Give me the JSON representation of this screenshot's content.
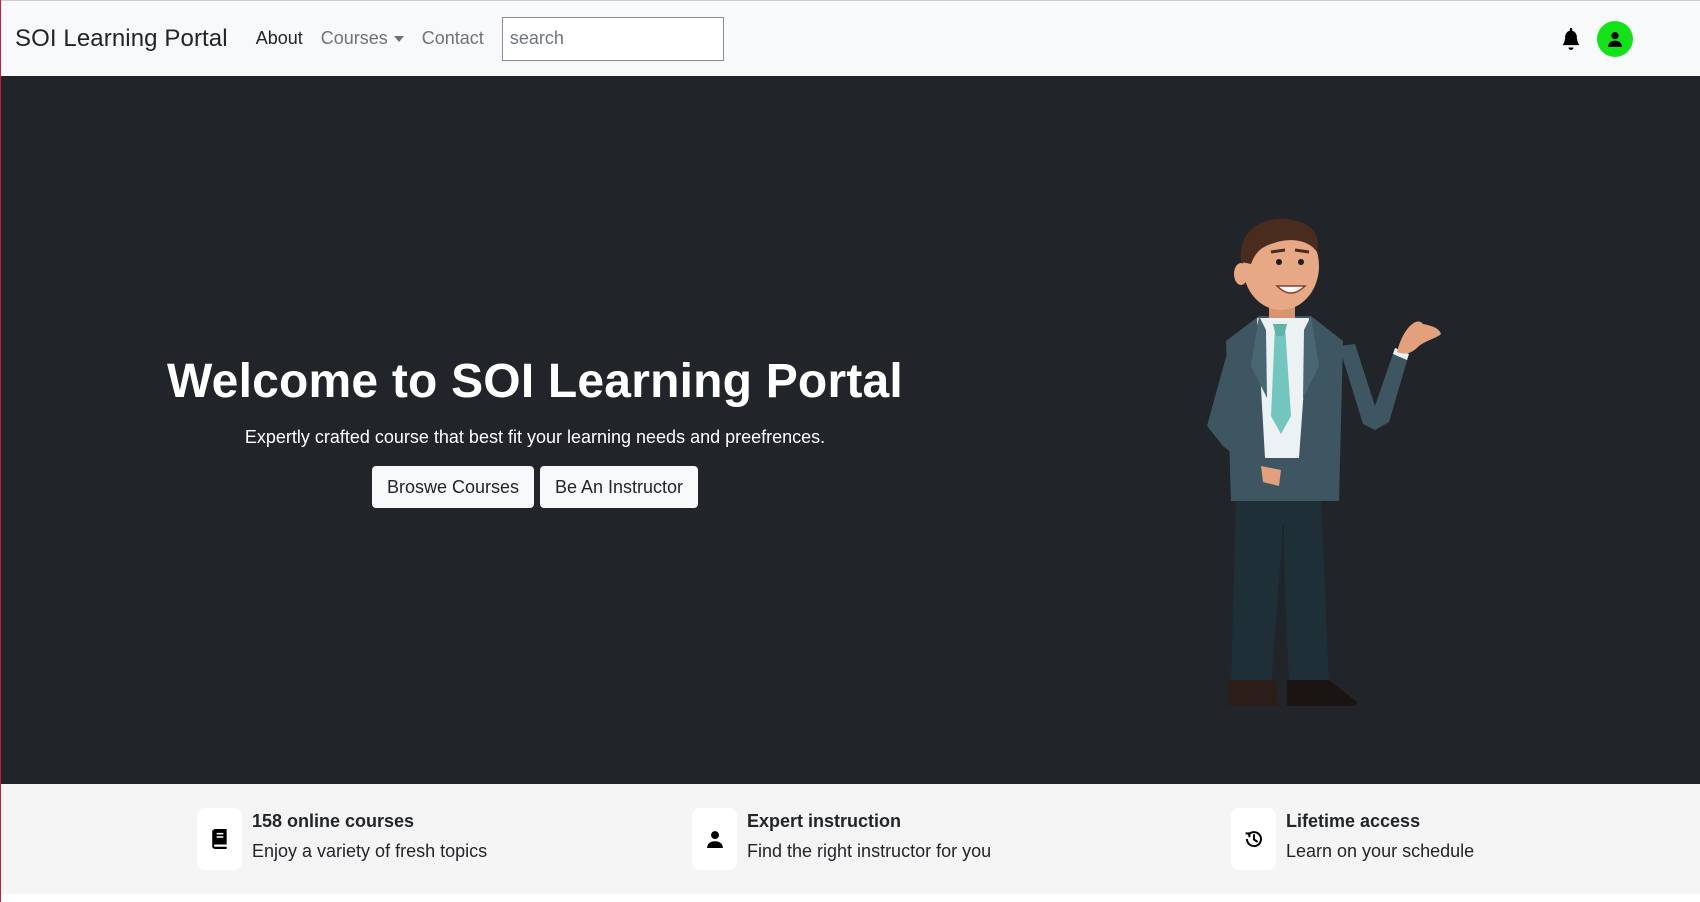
{
  "nav": {
    "brand": "SOI Learning Portal",
    "links": [
      {
        "label": "About"
      },
      {
        "label": "Courses"
      },
      {
        "label": "Contact"
      }
    ],
    "search_placeholder": "search",
    "avatar_color": "#14e11a"
  },
  "hero": {
    "title": "Welcome to SOI Learning Portal",
    "subtitle": "Expertly crafted course that best fit your learning needs and preefrences.",
    "buttons": [
      {
        "label": "Broswe Courses"
      },
      {
        "label": "Be An Instructor"
      }
    ],
    "background": "#212529"
  },
  "features": [
    {
      "icon": "book-icon",
      "title": "158 online courses",
      "desc": "Enjoy a variety of fresh topics"
    },
    {
      "icon": "person-icon",
      "title": "Expert instruction",
      "desc": "Find the right instructor for you"
    },
    {
      "icon": "history-icon",
      "title": "Lifetime access",
      "desc": "Learn on your schedule"
    }
  ]
}
